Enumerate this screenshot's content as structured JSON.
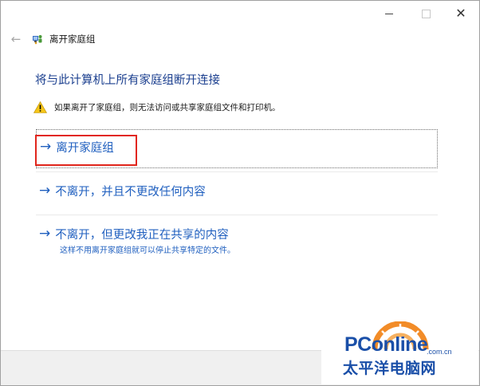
{
  "window": {
    "title": "离开家庭组",
    "heading": "将与此计算机上所有家庭组断开连接",
    "warning": "如果离开了家庭组，则无法访问或共享家庭组文件和打印机。"
  },
  "options": [
    {
      "label": "离开家庭组",
      "description": ""
    },
    {
      "label": "不离开，并且不更改任何内容",
      "description": ""
    },
    {
      "label": "不离开，但更改我正在共享的内容",
      "description": "这样不用离开家庭组就可以停止共享特定的文件。"
    }
  ],
  "caption_buttons": {
    "close": "✕"
  },
  "nav": {
    "back": "←",
    "arrow": "→"
  },
  "watermark": {
    "brand": "PConline",
    "domain": ".com.cn",
    "chinese": "太平洋电脑网"
  },
  "colors": {
    "link_blue": "#1f5fbf",
    "heading_blue": "#1b3f8f",
    "highlight_red": "#e1261c",
    "footer_gray": "#f0f0f0",
    "watermark_blue": "#1a4fa8",
    "watermark_orange": "#f28c28"
  },
  "icons": {
    "back": "arrow-left-icon",
    "app": "homegroup-icon",
    "warning": "warning-icon",
    "option_arrow": "arrow-right-icon"
  }
}
